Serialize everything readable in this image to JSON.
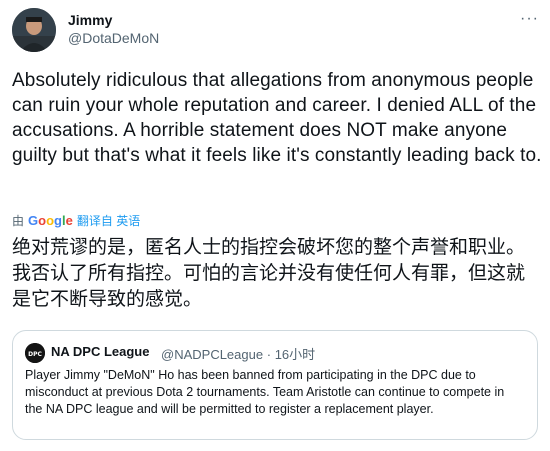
{
  "author": {
    "name": "Jimmy",
    "handle": "@DotaDeMoN"
  },
  "tweet": {
    "text": "Absolutely ridiculous that allegations from anonymous people can ruin your whole reputation and career. I denied ALL of the accusations.  A horrible statement does NOT make anyone guilty but that's what it feels like it's constantly leading back to.",
    "translated_by_prefix": "由",
    "translator": "Google",
    "translate_label": "翻译自 英语",
    "translation": "绝对荒谬的是，匿名人士的指控会破坏您的整个声誉和职业。我否认了所有指控。可怕的言论并没有使任何人有罪，但这就是它不断导致的感觉。"
  },
  "more_icon": "more-horizontal-icon",
  "quoted": {
    "name": "NA DPC League",
    "handle": "@NADPCLeague",
    "separator": "·",
    "time": "16小时",
    "avatar_text": "DPC",
    "text": "Player Jimmy \"DeMoN\" Ho has been banned from participating in the DPC due to misconduct at previous Dota 2 tournaments. Team Aristotle can continue to compete in the NA DPC league and will be permitted to register a replacement player."
  },
  "colors": {
    "text": "#0f1419",
    "muted": "#536471",
    "link": "#1d9bf0",
    "border": "#cfd9de"
  }
}
